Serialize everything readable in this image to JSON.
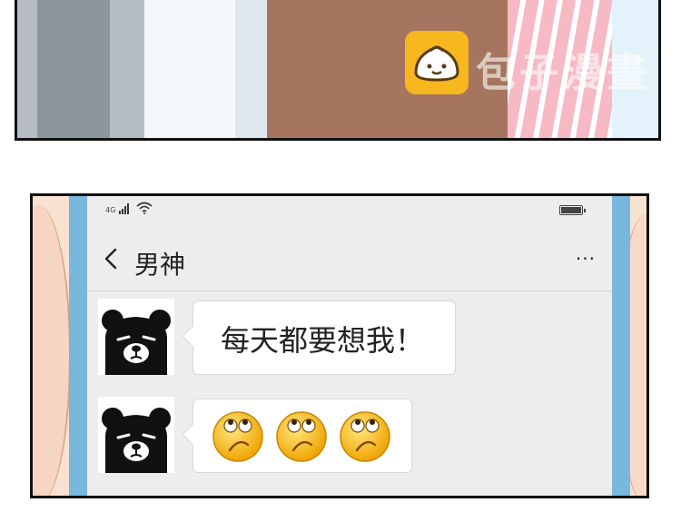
{
  "watermark": {
    "brand_text": "包子漫畫",
    "logo_icon": "bun-logo-icon",
    "logo_color": "#f6b71f"
  },
  "phone": {
    "status": {
      "network_label": "4G",
      "signal_icon": "signal-bars-icon",
      "wifi_icon": "wifi-icon",
      "battery_icon": "battery-icon"
    },
    "nav": {
      "back_icon": "chevron-left-icon",
      "title": "男神",
      "more_icon": "more-dots-icon",
      "more_glyph": "···"
    },
    "messages": [
      {
        "avatar_icon": "black-bear-avatar-icon",
        "text": "每天都要想我！"
      },
      {
        "avatar_icon": "black-bear-avatar-icon",
        "emojis": [
          "rolling-eyes-emoji",
          "rolling-eyes-emoji",
          "rolling-eyes-emoji"
        ]
      }
    ]
  },
  "colors": {
    "phone_frame": "#78b8dc",
    "screen_bg": "#ededed",
    "bubble_bg": "#ffffff"
  }
}
